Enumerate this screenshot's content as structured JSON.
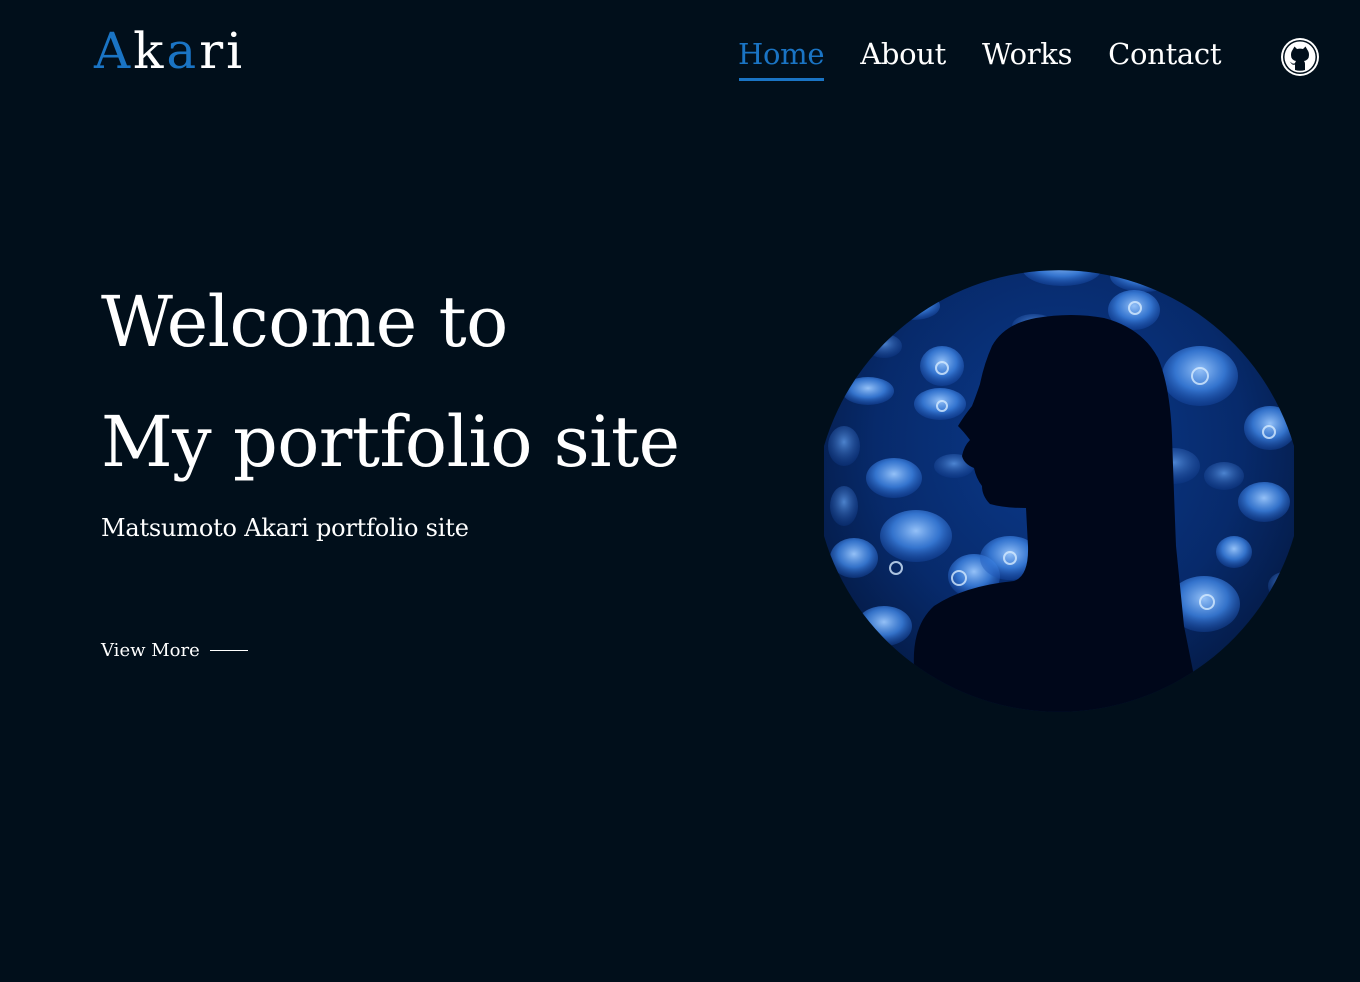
{
  "header": {
    "logo": [
      "A",
      "k",
      "a",
      "r",
      "i"
    ],
    "nav": [
      {
        "label": "Home",
        "active": true
      },
      {
        "label": "About",
        "active": false
      },
      {
        "label": "Works",
        "active": false
      },
      {
        "label": "Contact",
        "active": false
      }
    ],
    "github_icon": "github-icon"
  },
  "hero": {
    "title_line1": "Welcome to",
    "title_line2": "My portfolio site",
    "subtitle": "Matsumoto Akari portfolio site",
    "view_more": "View More",
    "image": "silhouette-jellyfish-image"
  },
  "colors": {
    "background": "#010f1b",
    "accent": "#1a74c4",
    "text": "#ffffff"
  }
}
